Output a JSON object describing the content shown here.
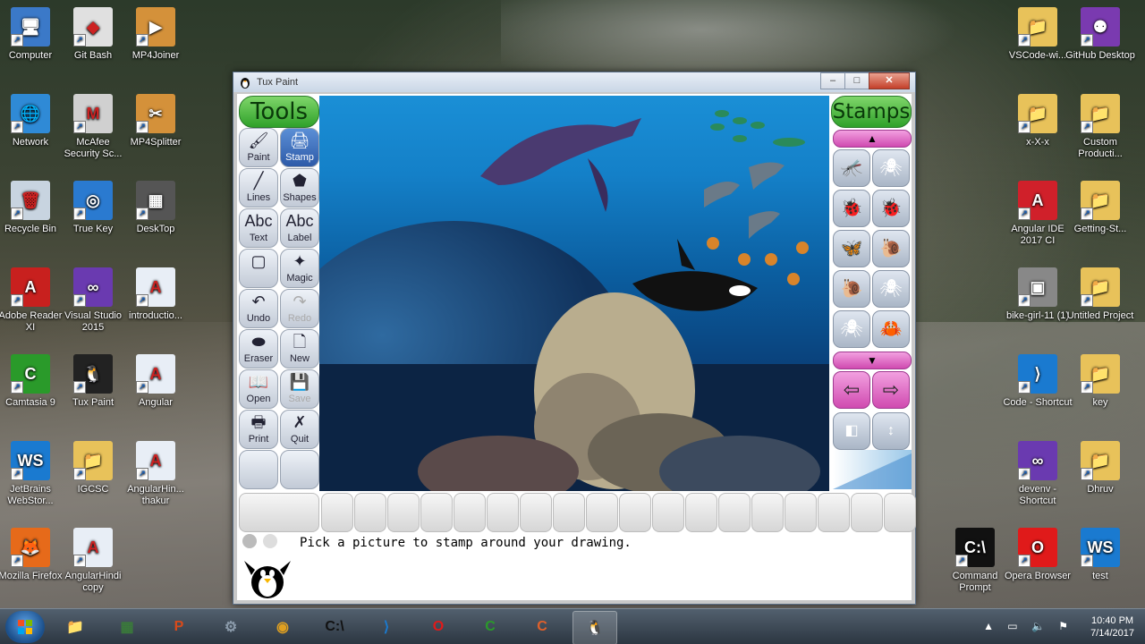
{
  "desktop": {
    "left_icons": [
      {
        "label": "Computer",
        "icon": "computer-icon"
      },
      {
        "label": "Git Bash",
        "icon": "git-bash-icon"
      },
      {
        "label": "MP4Joiner",
        "icon": "mp4joiner-icon"
      },
      {
        "label": "Network",
        "icon": "network-icon"
      },
      {
        "label": "McAfee Security Sc...",
        "icon": "mcafee-icon"
      },
      {
        "label": "MP4Splitter",
        "icon": "mp4splitter-icon"
      },
      {
        "label": "Recycle Bin",
        "icon": "recycle-bin-icon"
      },
      {
        "label": "True Key",
        "icon": "true-key-icon"
      },
      {
        "label": "DeskTop",
        "icon": "desktop-folder-icon"
      },
      {
        "label": "Adobe Reader XI",
        "icon": "adobe-reader-icon"
      },
      {
        "label": "Visual Studio 2015",
        "icon": "visual-studio-icon"
      },
      {
        "label": "introductio...",
        "icon": "document-icon"
      },
      {
        "label": "Camtasia 9",
        "icon": "camtasia-icon"
      },
      {
        "label": "Tux Paint",
        "icon": "tux-paint-icon"
      },
      {
        "label": "Angular",
        "icon": "document-icon"
      },
      {
        "label": "JetBrains WebStor...",
        "icon": "webstorm-icon"
      },
      {
        "label": "IGCSC",
        "icon": "folder-icon"
      },
      {
        "label": "AngularHin... thakur",
        "icon": "document-icon"
      },
      {
        "label": "Mozilla Firefox",
        "icon": "firefox-icon"
      },
      {
        "label": "AngularHindi copy",
        "icon": "document-icon"
      }
    ],
    "right_icons": [
      {
        "label": "VSCode-wi...",
        "icon": "folder-icon"
      },
      {
        "label": "GitHub Desktop",
        "icon": "github-icon"
      },
      {
        "label": "x-X-x",
        "icon": "folder-icon"
      },
      {
        "label": "Custom Producti...",
        "icon": "folder-icon"
      },
      {
        "label": "Angular IDE 2017 CI",
        "icon": "angular-icon"
      },
      {
        "label": "Getting-St...",
        "icon": "folder-icon"
      },
      {
        "label": "bike-girl-11 (1)",
        "icon": "image-icon"
      },
      {
        "label": "Untitled Project",
        "icon": "folder-icon"
      },
      {
        "label": "Code - Shortcut",
        "icon": "vscode-icon"
      },
      {
        "label": "key",
        "icon": "folder-icon"
      },
      {
        "label": "devenv - Shortcut",
        "icon": "visual-studio-icon"
      },
      {
        "label": "Dhruv",
        "icon": "folder-icon"
      },
      {
        "label": "Command Prompt",
        "icon": "command-prompt-icon"
      },
      {
        "label": "Opera Browser",
        "icon": "opera-icon"
      },
      {
        "label": "test",
        "icon": "webstorm-icon"
      }
    ]
  },
  "window": {
    "title": "Tux Paint",
    "min": "–",
    "max": "□",
    "close": "✕"
  },
  "tuxpaint": {
    "tools_header": "Tools",
    "stamps_header": "Stamps",
    "tools": [
      {
        "label": "Paint",
        "glyph": "🖌"
      },
      {
        "label": "Stamp",
        "glyph": "🖨"
      },
      {
        "label": "Lines",
        "glyph": "╱"
      },
      {
        "label": "Shapes",
        "glyph": "⬟"
      },
      {
        "label": "Text",
        "glyph": "Abc"
      },
      {
        "label": "Label",
        "glyph": "Abc"
      },
      {
        "label": "",
        "glyph": "▢"
      },
      {
        "label": "Magic",
        "glyph": "✦"
      },
      {
        "label": "Undo",
        "glyph": "↶"
      },
      {
        "label": "Redo",
        "glyph": "↷"
      },
      {
        "label": "Eraser",
        "glyph": "⬬"
      },
      {
        "label": "New",
        "glyph": "🗋"
      },
      {
        "label": "Open",
        "glyph": "📖"
      },
      {
        "label": "Save",
        "glyph": "💾"
      },
      {
        "label": "Print",
        "glyph": "🖶"
      },
      {
        "label": "Quit",
        "glyph": "✗"
      }
    ],
    "stamps": [
      "🦟",
      "🕷",
      "🐞",
      "🐞",
      "🦋",
      "🐌",
      "🐌",
      "🕷",
      "🕷",
      "🦀"
    ],
    "scroll_up": "▲",
    "scroll_down": "▼",
    "status": "Pick a picture to stamp around your drawing."
  },
  "taskbar": {
    "time": "10:40 PM",
    "date": "7/14/2017",
    "apps": [
      {
        "name": "explorer",
        "glyph": "📁"
      },
      {
        "name": "task-manager",
        "glyph": "▦"
      },
      {
        "name": "powerpoint",
        "glyph": "P"
      },
      {
        "name": "settings",
        "glyph": "⚙"
      },
      {
        "name": "chrome",
        "glyph": "◉"
      },
      {
        "name": "cmd",
        "glyph": "C:\\"
      },
      {
        "name": "vscode",
        "glyph": "⟩"
      },
      {
        "name": "opera",
        "glyph": "O"
      },
      {
        "name": "camtasia",
        "glyph": "C"
      },
      {
        "name": "camtasia-recorder",
        "glyph": "C"
      },
      {
        "name": "tux-paint",
        "glyph": "🐧"
      }
    ]
  }
}
